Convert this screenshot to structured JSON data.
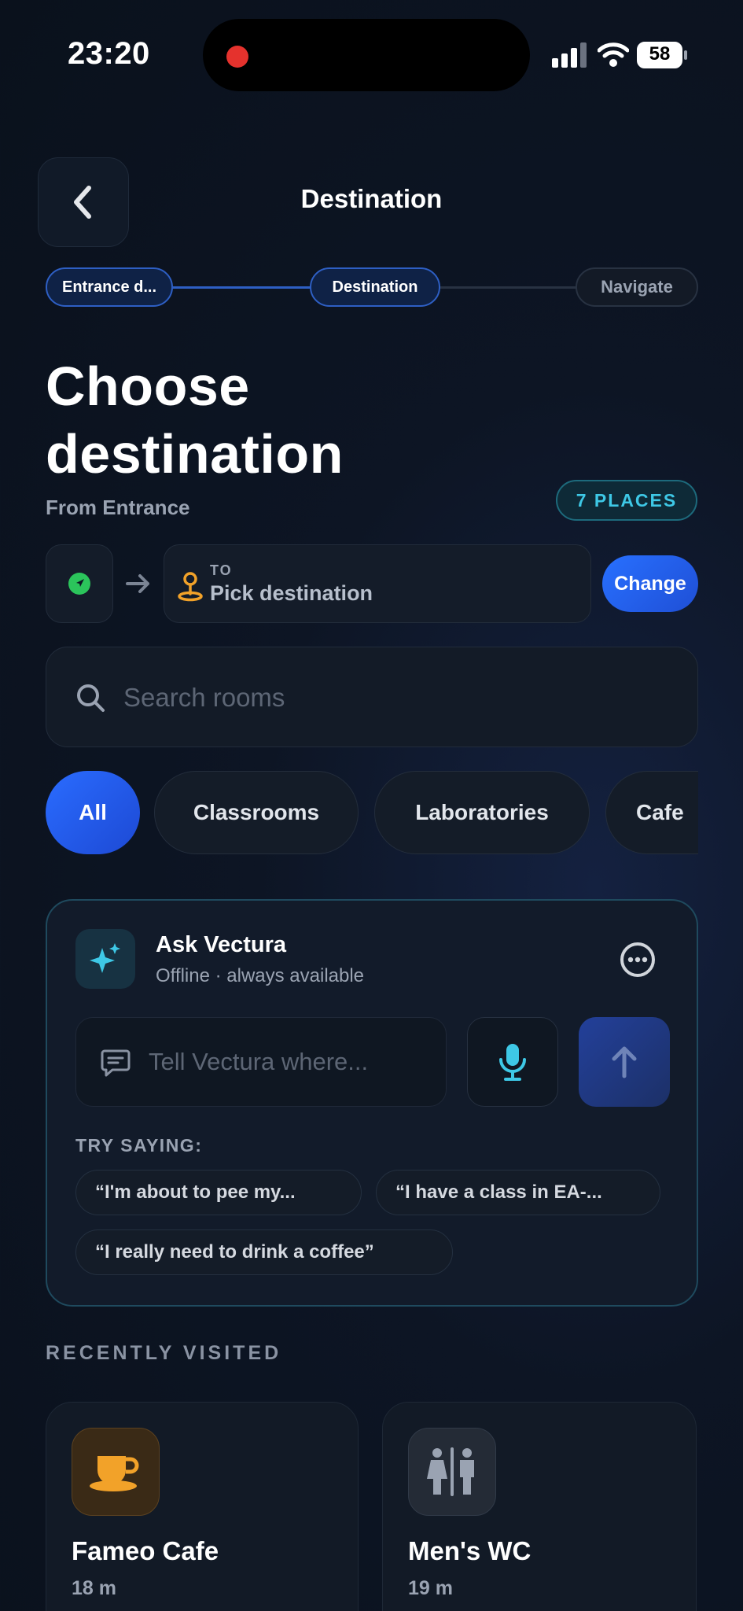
{
  "status_bar": {
    "time": "23:20",
    "battery": "58",
    "icons": [
      "recording-dot-icon",
      "signal-icon",
      "wifi-icon",
      "battery-icon"
    ]
  },
  "header": {
    "title": "Destination",
    "back_icon": "chevron-left-icon"
  },
  "stepper": {
    "steps": [
      {
        "label": "Entrance d..."
      },
      {
        "label": "Destination"
      },
      {
        "label": "Navigate"
      }
    ]
  },
  "heading": {
    "line1": "Choose",
    "line2": "destination",
    "subtitle": "From Entrance",
    "places_badge": "7 PLACES"
  },
  "route": {
    "origin_icon": "location-arrow-icon",
    "to_label": "TO",
    "to_value": "Pick destination",
    "change_label": "Change"
  },
  "search": {
    "placeholder": "Search rooms",
    "value": ""
  },
  "filters": {
    "chips": [
      {
        "label": "All",
        "active": true
      },
      {
        "label": "Classrooms"
      },
      {
        "label": "Laboratories"
      },
      {
        "label": "Cafe"
      }
    ]
  },
  "ask": {
    "title": "Ask Vectura",
    "subtitle": "Offline · always available",
    "input_placeholder": "Tell Vectura where...",
    "try_label": "TRY SAYING:",
    "suggestions": [
      "“I'm about to pee my...",
      "“I have a class in EA-...",
      "“I really need to drink a coffee”"
    ]
  },
  "recent": {
    "label": "RECENTLY VISITED",
    "items": [
      {
        "title": "Fameo Cafe",
        "distance": "18 m",
        "icon": "coffee-cup-icon"
      },
      {
        "title": "Men's WC",
        "distance": "19 m",
        "icon": "restroom-icon"
      }
    ]
  },
  "colors": {
    "accent_blue": "#2870ff",
    "accent_cyan": "#3ec8e6",
    "background": "#0d1524",
    "origin_green": "#2bc45b",
    "pin_orange": "#f2a229"
  }
}
